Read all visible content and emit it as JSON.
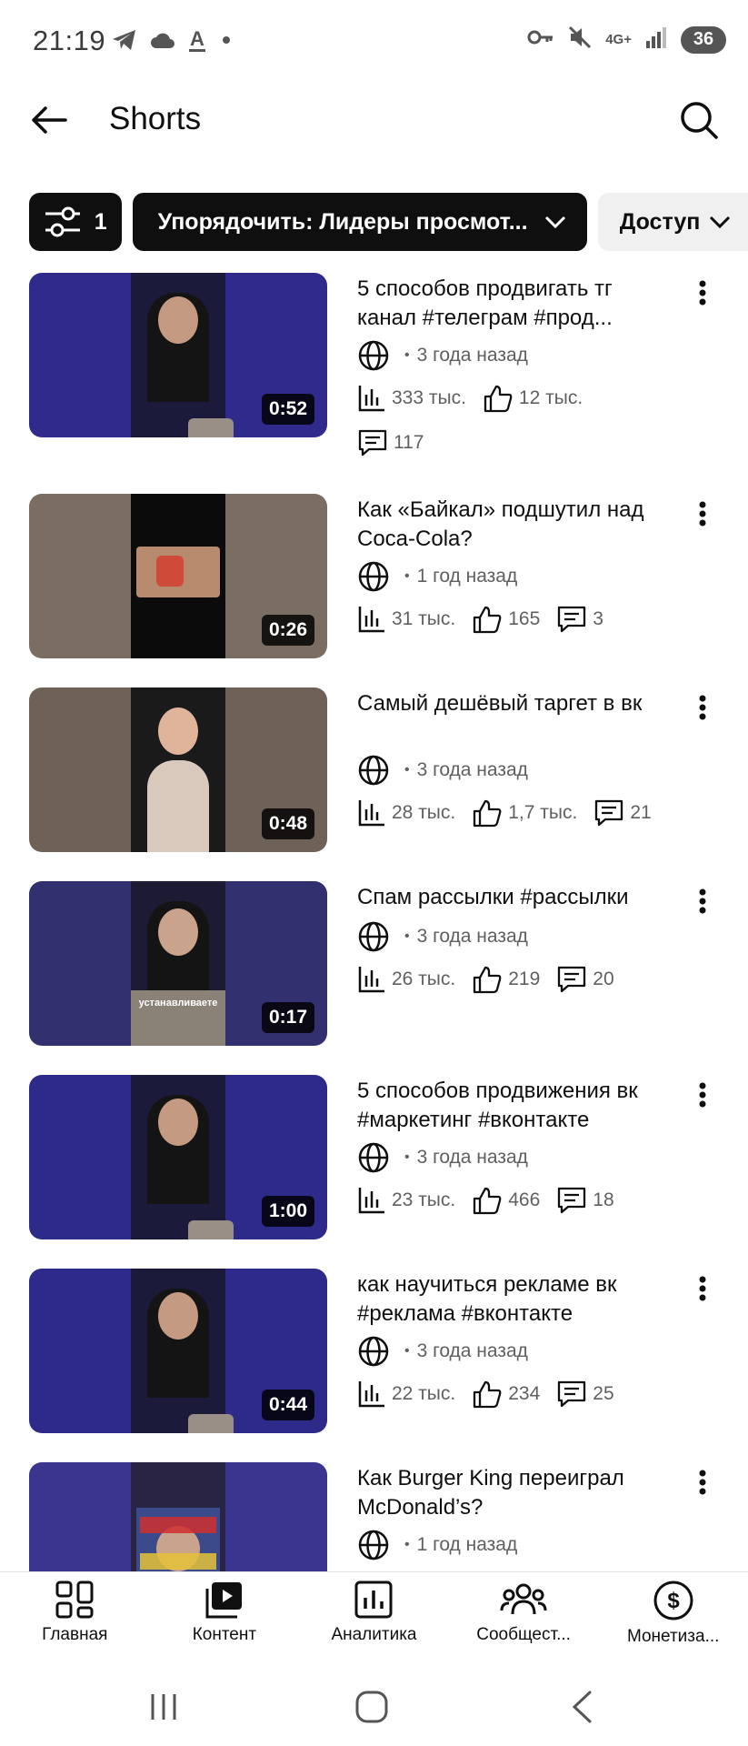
{
  "status_bar": {
    "time": "21:19",
    "network": "4G+",
    "battery": "36"
  },
  "header": {
    "title": "Shorts"
  },
  "filters": {
    "filter_count": "1",
    "sort_label": "Упорядочить: Лидеры просмот...",
    "access_label": "Доступ"
  },
  "videos": [
    {
      "title": "5 способов продвигать тг канал #телеграм #прод...",
      "age": "3 года назад",
      "views": "333 тыс.",
      "likes": "12 тыс.",
      "comments": "117",
      "duration": "0:52"
    },
    {
      "title": "Как «Байкал» подшутил над Coca-Cola?",
      "age": "1 год назад",
      "views": "31 тыс.",
      "likes": "165",
      "comments": "3",
      "duration": "0:26"
    },
    {
      "title": "Самый дешёвый таргет в вк",
      "age": "3 года назад",
      "views": "28 тыс.",
      "likes": "1,7 тыс.",
      "comments": "21",
      "duration": "0:48"
    },
    {
      "title": "Спам рассылки #рассылки",
      "age": "3 года назад",
      "views": "26 тыс.",
      "likes": "219",
      "comments": "20",
      "duration": "0:17",
      "overlay_text": "устанавливаете"
    },
    {
      "title": "5 способов продвижения вк #маркетинг #вконтакте",
      "age": "3 года назад",
      "views": "23 тыс.",
      "likes": "466",
      "comments": "18",
      "duration": "1:00"
    },
    {
      "title": "как научиться рекламе вк #реклама #вконтакте",
      "age": "3 года назад",
      "views": "22 тыс.",
      "likes": "234",
      "comments": "25",
      "duration": "0:44"
    },
    {
      "title": "Как Burger King переиграл McDonald’s?",
      "age": "1 год назад"
    }
  ],
  "bottom_nav": [
    {
      "label": "Главная",
      "icon": "dashboard-icon"
    },
    {
      "label": "Контент",
      "icon": "content-icon"
    },
    {
      "label": "Аналитика",
      "icon": "analytics-icon"
    },
    {
      "label": "Сообщест...",
      "icon": "community-icon"
    },
    {
      "label": "Монетиза...",
      "icon": "monetization-icon"
    }
  ],
  "colors": {
    "accent_dark": "#0f0f0f",
    "chip_light": "#f0f0f0",
    "meta_text": "#606060"
  }
}
